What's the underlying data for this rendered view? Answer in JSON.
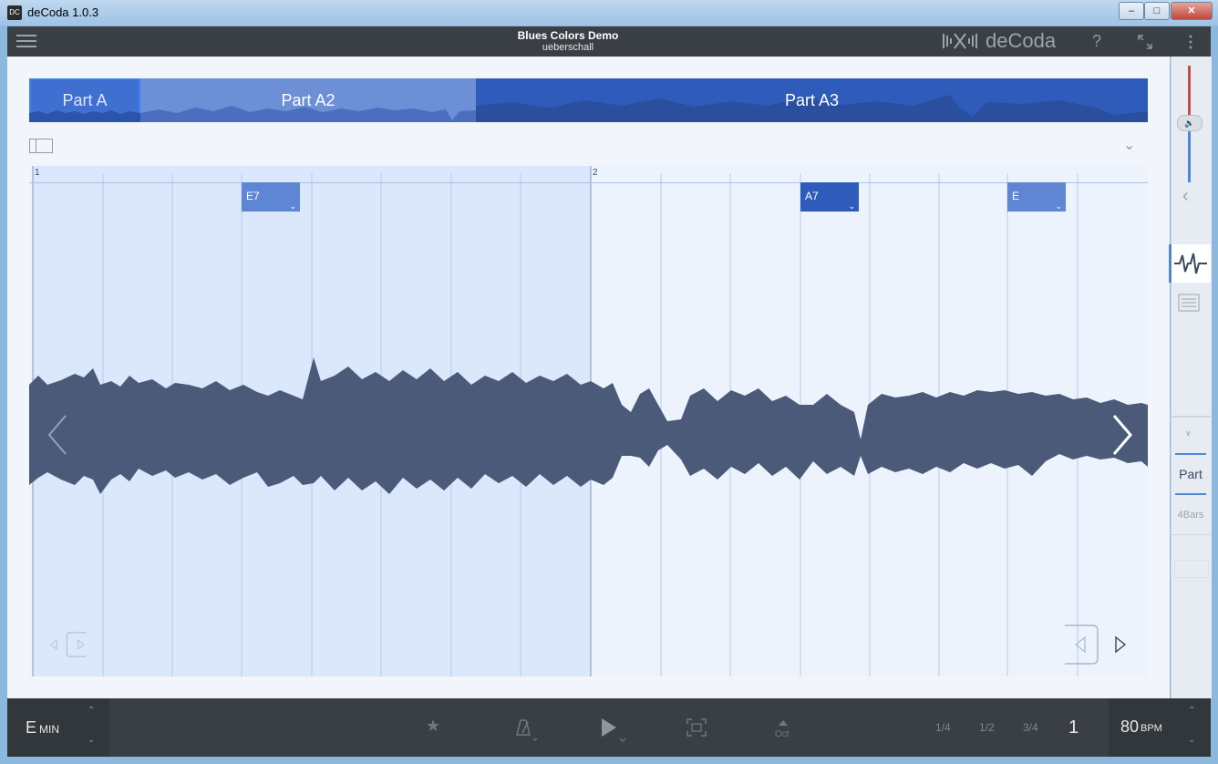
{
  "window": {
    "title": "deCoda 1.0.3",
    "app_icon": "decoda-icon"
  },
  "header": {
    "song_title": "Blues Colors Demo",
    "artist": "ueberschall",
    "brand": "deCoda",
    "help": "?",
    "menu_icon": "hamburger-icon",
    "fullscreen_icon": "fullscreen-icon",
    "more_icon": "more-vertical-icon"
  },
  "parts": [
    {
      "label": "Part A",
      "selected": true
    },
    {
      "label": "Part A2",
      "selected": false
    },
    {
      "label": "Part A3",
      "selected": false
    }
  ],
  "waveform": {
    "bars": [
      "1",
      "2"
    ],
    "chords": [
      {
        "label": "E7"
      },
      {
        "label": "A7"
      },
      {
        "label": "E"
      }
    ]
  },
  "side_panel": {
    "mode_part": "Part",
    "mode_bars": "4Bars"
  },
  "bottom": {
    "key_root": "E",
    "key_mode": "MIN",
    "octave_label": "Oct",
    "speeds": [
      "1/4",
      "1/2",
      "3/4"
    ],
    "speed_current": "1",
    "bpm_value": "80",
    "bpm_unit": "BPM"
  },
  "colors": {
    "accent": "#4f87d6",
    "part_selected": "#3f6fd0",
    "waveform": "#4a5a78",
    "header_bg": "#3a3f45"
  }
}
